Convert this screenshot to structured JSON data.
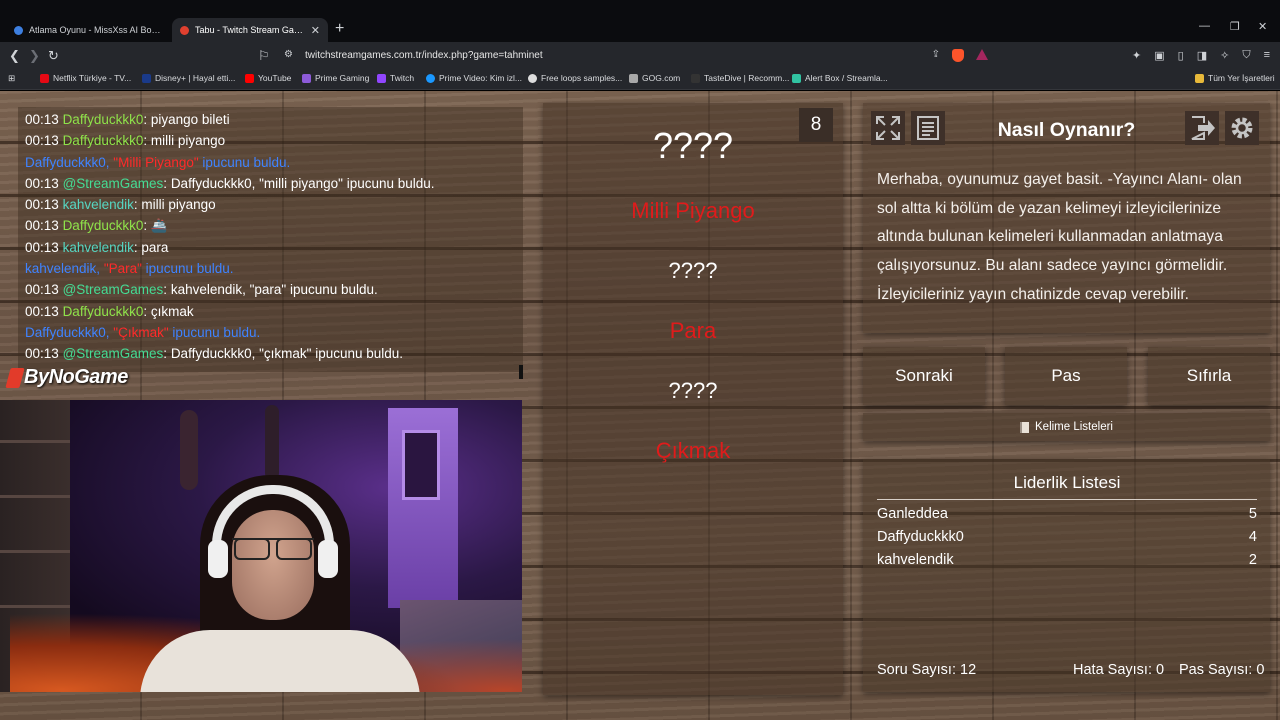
{
  "browser": {
    "tabs": [
      {
        "title": "Atlama Oyunu - MissXss AI Bot System",
        "active": false
      },
      {
        "title": "Tabu - Twitch Stream Games",
        "active": true
      }
    ],
    "url": "twitchstreamgames.com.tr/index.php?game=tahminet",
    "bookmarks": [
      "Netflix Türkiye - TV...",
      "Disney+ | Hayal etti...",
      "YouTube",
      "Prime Gaming",
      "Twitch",
      "Prime Video: Kim izl...",
      "Free loops samples...",
      "GOG.com",
      "TasteDive | Recomm...",
      "Alert Box / Streamla..."
    ],
    "other_bookmarks": "Tüm Yer İşaretleri"
  },
  "chat": {
    "lines": [
      {
        "kind": "msg",
        "time": "00:13",
        "user": "Daffyduckkk0",
        "sep": ": ",
        "text": "piyango bileti",
        "color": "green"
      },
      {
        "kind": "msg",
        "time": "00:13",
        "user": "Daffyduckkk0",
        "sep": ": ",
        "text": "milli piyango",
        "color": "green"
      },
      {
        "kind": "sys",
        "pre": "Daffyduckkk0, ",
        "hl": "\"Milli Piyango\"",
        "post": " ipucunu buldu."
      },
      {
        "kind": "msg",
        "time": "00:13",
        "user": "@StreamGames",
        "sep": ": ",
        "text": "Daffyduckkk0, \"milli piyango\" ipucunu buldu.",
        "color": "sg"
      },
      {
        "kind": "msg",
        "time": "00:13",
        "user": "kahvelendik",
        "sep": ": ",
        "text": "milli piyango",
        "color": "teal"
      },
      {
        "kind": "msg",
        "time": "00:13",
        "user": "Daffyduckkk0",
        "sep": ": ",
        "text": "🚢",
        "color": "green"
      },
      {
        "kind": "msg",
        "time": "00:13",
        "user": "kahvelendik",
        "sep": ": ",
        "text": "para",
        "color": "teal"
      },
      {
        "kind": "sys",
        "pre": "kahvelendik, ",
        "hl": "\"Para\"",
        "post": " ipucunu buldu."
      },
      {
        "kind": "msg",
        "time": "00:13",
        "user": "@StreamGames",
        "sep": ": ",
        "text": "kahvelendik, \"para\" ipucunu buldu.",
        "color": "sg"
      },
      {
        "kind": "msg",
        "time": "00:13",
        "user": "Daffyduckkk0",
        "sep": ": ",
        "text": "çıkmak",
        "color": "green"
      },
      {
        "kind": "sys",
        "pre": "Daffyduckkk0, ",
        "hl": "\"Çıkmak\"",
        "post": " ipucunu buldu."
      },
      {
        "kind": "msg",
        "time": "00:13",
        "user": "@StreamGames",
        "sep": ": ",
        "text": "Daffyduckkk0, \"çıkmak\" ipucunu buldu.",
        "color": "sg"
      }
    ]
  },
  "logo": "ByNoGame",
  "card": {
    "counter": "8",
    "words": [
      {
        "text": "????",
        "found": false
      },
      {
        "text": "Milli Piyango",
        "found": true
      },
      {
        "text": "????",
        "found": false
      },
      {
        "text": "Para",
        "found": true
      },
      {
        "text": "????",
        "found": false
      },
      {
        "text": "Çıkmak",
        "found": true
      }
    ]
  },
  "howto": {
    "title": "Nasıl Oynanır?",
    "text": "Merhaba, oyunumuz gayet basit. -Yayıncı Alanı- olan sol altta ki bölüm de yazan kelimeyi izleyicilerinize altında bulunan kelimeleri kullanmadan anlatmaya çalışıyorsunuz. Bu alanı sadece yayıncı görmelidir. İzleyicileriniz yayın chatinizde cevap verebilir."
  },
  "buttons": {
    "next": "Sonraki",
    "pass": "Pas",
    "reset": "Sıfırla",
    "word_lists": "Kelime Listeleri"
  },
  "leaderboard": {
    "title": "Liderlik Listesi",
    "rows": [
      {
        "name": "Ganleddea",
        "score": "5"
      },
      {
        "name": "Daffyduckkk0",
        "score": "4"
      },
      {
        "name": "kahvelendik",
        "score": "2"
      }
    ]
  },
  "stats": {
    "questions": "Soru Sayısı: 12",
    "errors": "Hata Sayısı: 0",
    "passes": "Pas Sayısı: 0"
  },
  "colors": {
    "found_word": "#e01b1b",
    "system_msg": "#3f83ff",
    "user_green": "#8fe34a",
    "user_teal": "#55d6c2"
  }
}
